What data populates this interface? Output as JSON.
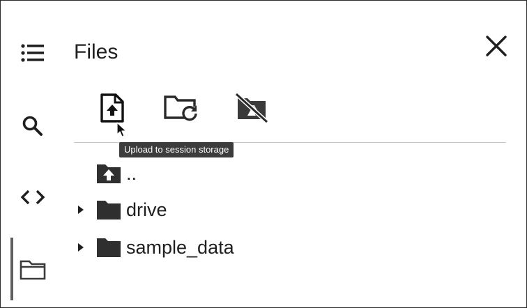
{
  "panel": {
    "title": "Files"
  },
  "rail": {
    "items": [
      {
        "icon": "table-of-contents-icon"
      },
      {
        "icon": "search-icon"
      },
      {
        "icon": "code-snippets-icon"
      },
      {
        "icon": "folder-icon",
        "active": true
      }
    ]
  },
  "toolbar": {
    "buttons": [
      {
        "icon": "upload-file-icon"
      },
      {
        "icon": "refresh-folder-icon"
      },
      {
        "icon": "mount-drive-off-icon"
      }
    ],
    "tooltip": "Upload to session storage"
  },
  "files": {
    "parent": {
      "name": "..",
      "icon": "parent-folder-icon"
    },
    "items": [
      {
        "name": "drive",
        "icon": "folder-icon",
        "expandable": true
      },
      {
        "name": "sample_data",
        "icon": "folder-icon",
        "expandable": true
      }
    ]
  }
}
